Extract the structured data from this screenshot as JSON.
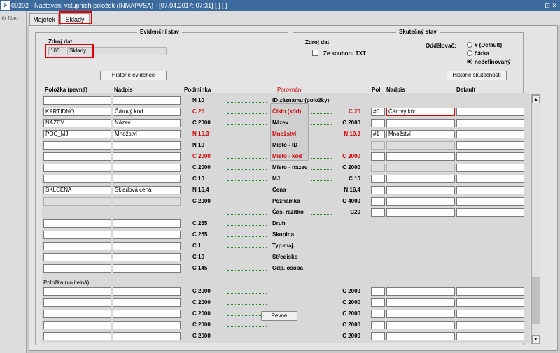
{
  "titlebar": {
    "title": "09202 - Nastavení vstupních položek (INMAPVSA) - [07.04.2017; 07:31]  [ ]  [ ]",
    "controls": "⊡ ✕"
  },
  "nav": {
    "label": "Nav"
  },
  "tabs": [
    {
      "label": "Majetek"
    },
    {
      "label": "Sklady"
    }
  ],
  "evid": {
    "title": "Evidenční stav",
    "zdroj_label": "Zdroj dat",
    "zdroj_code": "105",
    "zdroj_name": "Sklady",
    "history_btn": "Historie evidence"
  },
  "skut": {
    "title": "Skutečný stav",
    "zdroj_label": "Zdroj dat",
    "ze_souboru": "Ze souboru TXT",
    "oddelovac_label": "Oddělovač:",
    "opt1": "# (Default)",
    "opt2": "čárka",
    "opt3": "nedefinovaný",
    "history_btn": "Historie skutečnosti"
  },
  "headers": {
    "polozka": "Položka  (pevná)",
    "nadpis": "Nadpis",
    "podminka": "Podmínka",
    "porovnani": "Porovnání",
    "pol": "Pol",
    "nadpis2": "Nadpis",
    "default": "Default"
  },
  "rows": [
    {
      "pol": "",
      "nad": "",
      "cond": "N 10",
      "field": "ID záznamu (položky)",
      "cond2": "",
      "rp": "",
      "rn": "",
      "rd": ""
    },
    {
      "pol": "KARTIDNO",
      "nad": "Čárový kód",
      "cond": "C 20",
      "field": "Číslo (kód)",
      "cond2": "C 20",
      "rp": "#0",
      "rn": "Čárový kód",
      "rd": ""
    },
    {
      "pol": "NAZEV",
      "nad": "Název",
      "cond": "C 2000",
      "field": "Název",
      "cond2": "C 2000",
      "rp": "",
      "rn": "",
      "rd": ""
    },
    {
      "pol": "POC_MJ",
      "nad": "Množství",
      "cond": "N 10,3",
      "field": "Množství",
      "cond2": "N 10,3",
      "rp": "#1",
      "rn": "Množství",
      "rd": ""
    },
    {
      "pol": "",
      "nad": "",
      "cond": "N 10",
      "field": "Místo - ID",
      "cond2": "",
      "rp": "",
      "rn": "",
      "rd": ""
    },
    {
      "pol": "",
      "nad": "",
      "cond": "C 2000",
      "field": "Místo - kód",
      "cond2": "C 2000",
      "rp": "",
      "rn": "",
      "rd": ""
    },
    {
      "pol": "",
      "nad": "",
      "cond": "C 2000",
      "field": "Místo - název",
      "cond2": "C 2000",
      "rp": "",
      "rn": "",
      "rd": ""
    },
    {
      "pol": "",
      "nad": "",
      "cond": "C 10",
      "field": "MJ",
      "cond2": "C 10",
      "rp": "",
      "rn": "",
      "rd": ""
    },
    {
      "pol": "SKLCENA",
      "nad": "Skladová cena",
      "cond": "N 16,4",
      "field": "Cena",
      "cond2": "N 16,4",
      "rp": "",
      "rn": "",
      "rd": ""
    },
    {
      "pol": "",
      "nad": "",
      "cond": "C 2000",
      "field": "Poznámka",
      "cond2": "C 4000",
      "rp": "",
      "rn": "",
      "rd": ""
    },
    {
      "pol": "",
      "nad": "",
      "cond": "",
      "field": "Čas. razítko",
      "cond2": "C20",
      "rp": "",
      "rn": "",
      "rd": ""
    },
    {
      "pol": "",
      "nad": "",
      "cond": "C 255",
      "field": "Druh",
      "cond2": "",
      "rp": "",
      "rn": "",
      "rd": ""
    },
    {
      "pol": "",
      "nad": "",
      "cond": "C 255",
      "field": "Skupina",
      "cond2": "",
      "rp": "",
      "rn": "",
      "rd": ""
    },
    {
      "pol": "",
      "nad": "",
      "cond": "C 1",
      "field": "Typ maj.",
      "cond2": "",
      "rp": "",
      "rn": "",
      "rd": ""
    },
    {
      "pol": "",
      "nad": "",
      "cond": "C 10",
      "field": "Středisko",
      "cond2": "",
      "rp": "",
      "rn": "",
      "rd": ""
    },
    {
      "pol": "",
      "nad": "",
      "cond": "C 145",
      "field": "Odp. osoba",
      "cond2": "",
      "rp": "",
      "rn": "",
      "rd": ""
    }
  ],
  "volitelna_label": "Položka  (volitelná)",
  "vol_rows": [
    {
      "cond": "C 2000",
      "cond2": "C 2000"
    },
    {
      "cond": "C 2000",
      "cond2": "C 2000"
    },
    {
      "cond": "C 2000",
      "cond2": "C 2000"
    },
    {
      "cond": "C 2000",
      "cond2": "C 2000"
    },
    {
      "cond": "C 2000",
      "cond2": "C 2000"
    }
  ],
  "pevne_btn": "Pevné",
  "colors": {
    "red": "#d40000",
    "title_bar": "#3c6a9c",
    "dots": "#1a8a1a"
  }
}
